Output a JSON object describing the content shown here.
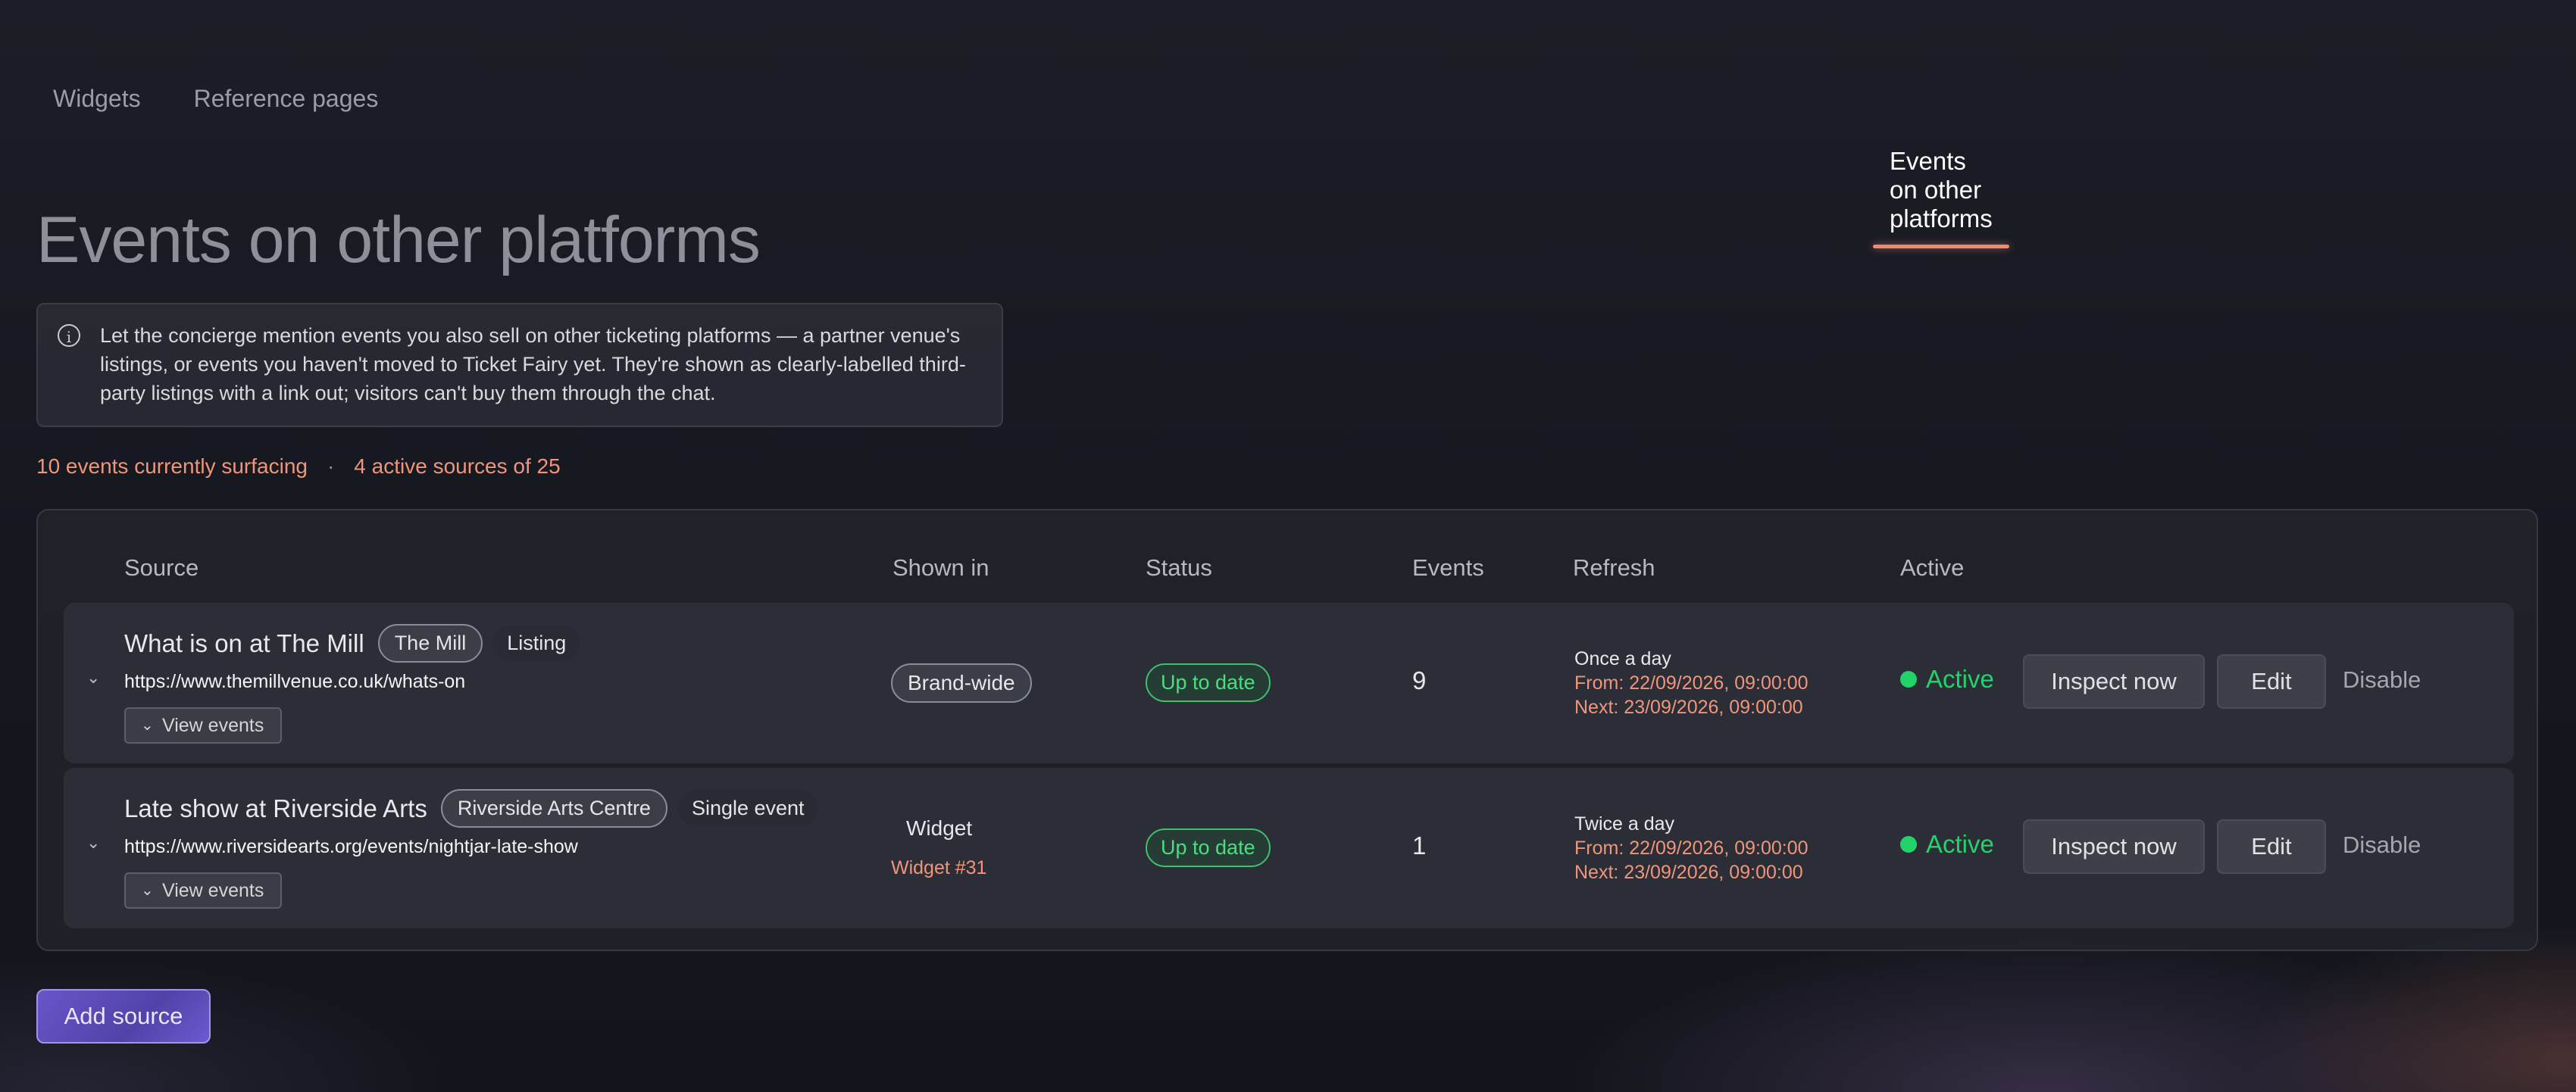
{
  "tabs": [
    {
      "label": "Widgets"
    },
    {
      "label": "Events on other platforms"
    },
    {
      "label": "Reference pages"
    }
  ],
  "page_title": "Events on other platforms",
  "info_text": "Let the concierge mention events you also sell on other ticketing platforms — a partner venue's listings, or events you haven't moved to Ticket Fairy yet. They're shown as clearly-labelled third-party listings with a link out; visitors can't buy them through the chat.",
  "summary": {
    "events": "10 events currently surfacing",
    "separator": "·",
    "sources": "4 active sources of 25"
  },
  "table": {
    "headers": {
      "source": "Source",
      "shown_in": "Shown in",
      "status": "Status",
      "events": "Events",
      "refresh": "Refresh",
      "active": "Active"
    },
    "rows": [
      {
        "name": "What is on at The Mill",
        "venue": "The Mill",
        "type": "Listing",
        "url": "https://www.themillvenue.co.uk/whats-on",
        "view_events": "View events",
        "shown_in": "Brand-wide",
        "shown_in_sub": "",
        "status": "Up to date",
        "events": "9",
        "refresh_freq": "Once a day",
        "refresh_from": "From: 22/09/2026, 09:00:00",
        "refresh_next": "Next: 23/09/2026, 09:00:00",
        "active": "Active",
        "inspect": "Inspect now",
        "edit": "Edit",
        "disable": "Disable"
      },
      {
        "name": "Late show at Riverside Arts",
        "venue": "Riverside Arts Centre",
        "type": "Single event",
        "url": "https://www.riversidearts.org/events/nightjar-late-show",
        "view_events": "View events",
        "shown_in": "Widget",
        "shown_in_sub": "Widget #31",
        "status": "Up to date",
        "events": "1",
        "refresh_freq": "Twice a day",
        "refresh_from": "From: 22/09/2026, 09:00:00",
        "refresh_next": "Next: 23/09/2026, 09:00:00",
        "active": "Active",
        "inspect": "Inspect now",
        "edit": "Edit",
        "disable": "Disable"
      }
    ]
  },
  "add_source": "Add source",
  "icons": {
    "info": "info-icon",
    "chevron": "chevron-down-icon",
    "status_dot": "active-dot-icon"
  },
  "colors": {
    "accent": "#f28a6c",
    "success": "#22d36a",
    "primary_button": "#5a49b8"
  }
}
